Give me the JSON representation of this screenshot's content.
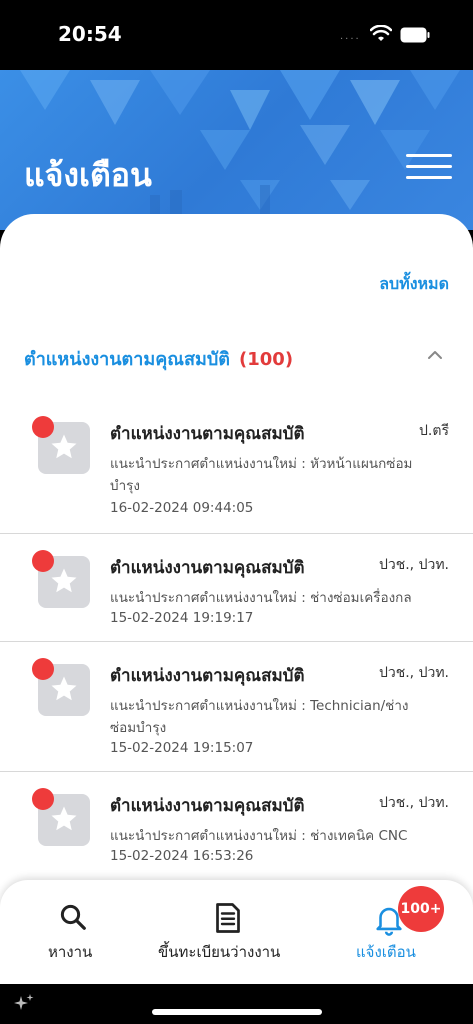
{
  "status_bar": {
    "time": "20:54",
    "dots": "...."
  },
  "header": {
    "title": "แจ้งเตือน"
  },
  "actions": {
    "delete_all": "ลบทั้งหมด"
  },
  "section": {
    "title": "ตำแหน่งงานตามคุณสมบัติ",
    "count": "(100)"
  },
  "notifications": [
    {
      "title": "ตำแหน่งงานตามคุณสมบัติ",
      "level": "ป.ตรี",
      "desc_line1": "แนะนำประกาศตำแหน่งงานใหม่ : หัวหน้าแผนกซ่อม",
      "desc_line2": "บำรุง",
      "date": "16-02-2024 09:44:05",
      "unread": true
    },
    {
      "title": "ตำแหน่งงานตามคุณสมบัติ",
      "level": "ปวช., ปวท.",
      "desc_line1": "แนะนำประกาศตำแหน่งงานใหม่ : ช่างซ่อมเครื่องกล",
      "desc_line2": "",
      "date": "15-02-2024 19:19:17",
      "unread": true
    },
    {
      "title": "ตำแหน่งงานตามคุณสมบัติ",
      "level": "ปวช., ปวท.",
      "desc_line1": "แนะนำประกาศตำแหน่งงานใหม่ : Technician/ช่าง",
      "desc_line2": "ซ่อมบำรุง",
      "date": "15-02-2024 19:15:07",
      "unread": true
    },
    {
      "title": "ตำแหน่งงานตามคุณสมบัติ",
      "level": "ปวช., ปวท.",
      "desc_line1": "แนะนำประกาศตำแหน่งงานใหม่ : ช่างเทคนิค CNC",
      "desc_line2": "",
      "date": "15-02-2024 16:53:26",
      "unread": true
    }
  ],
  "tabs": [
    {
      "label": "หางาน",
      "icon": "search-icon"
    },
    {
      "label": "ขึ้นทะเบียนว่างงาน",
      "icon": "document-icon"
    },
    {
      "label": "แจ้งเตือน",
      "icon": "bell-icon"
    }
  ],
  "badge": {
    "count": "100+"
  },
  "colors": {
    "accent": "#1a8fe0",
    "header": "#2f7ad6",
    "alert": "#ee3b3b"
  }
}
